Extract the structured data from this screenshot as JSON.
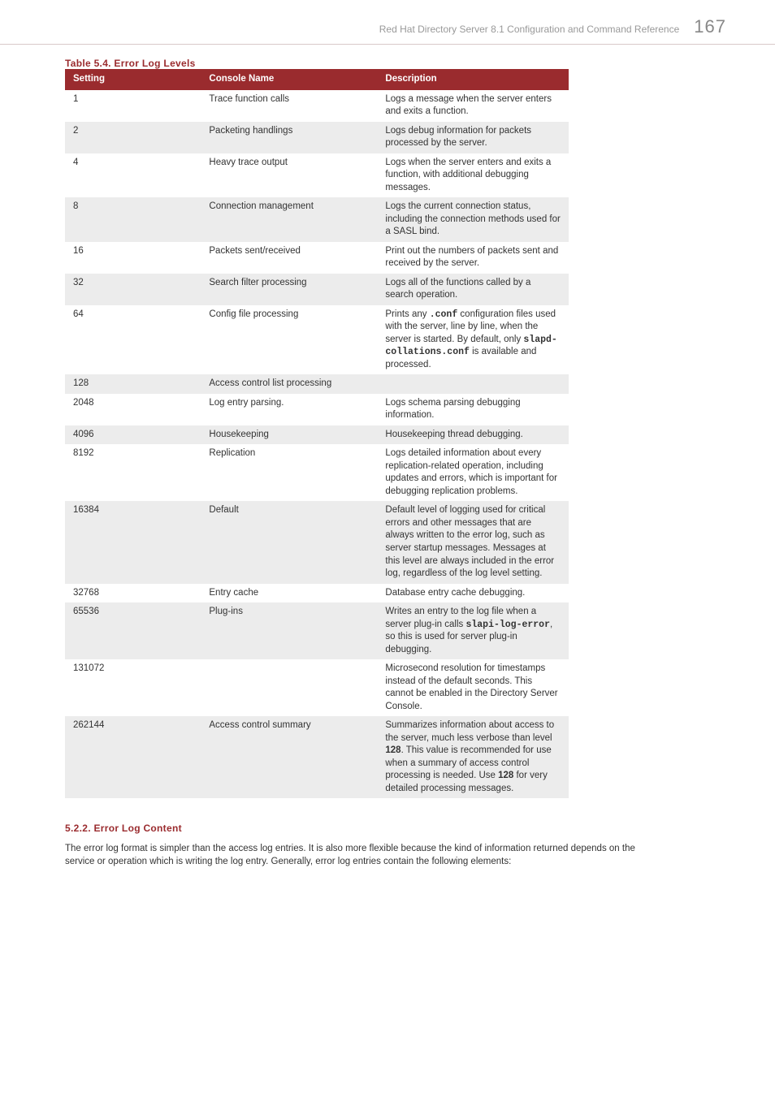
{
  "header": {
    "title": "Red Hat Directory Server 8.1 Configuration and Command Reference",
    "page_number": "167"
  },
  "table": {
    "caption": "Table 5.4. Error Log Levels",
    "headers": {
      "setting": "Setting",
      "console": "Console Name",
      "description": "Description"
    },
    "rows": [
      {
        "setting": "1",
        "console": "Trace function calls",
        "description": "Logs a message when the server enters and exits a function."
      },
      {
        "setting": "2",
        "console": "Packeting handlings",
        "description": "Logs debug information for packets processed by the server."
      },
      {
        "setting": "4",
        "console": "Heavy trace output",
        "description": "Logs when the server enters and exits a function, with additional debugging messages."
      },
      {
        "setting": "8",
        "console": "Connection management",
        "description": "Logs the current connection status, including the connection methods used for a SASL bind."
      },
      {
        "setting": "16",
        "console": "Packets sent/received",
        "description": "Print out the numbers of packets sent and received by the server."
      },
      {
        "setting": "32",
        "console": "Search filter processing",
        "description": "Logs all of the functions called by a search operation."
      },
      {
        "setting": "64",
        "console": "Config file processing",
        "description_parts": [
          {
            "t": "text",
            "v": "Prints any "
          },
          {
            "t": "code",
            "v": ".conf"
          },
          {
            "t": "text",
            "v": " configuration files used with the server, line by line, when the server is started. By default, only "
          },
          {
            "t": "code",
            "v": "slapd-collations.conf"
          },
          {
            "t": "text",
            "v": " is available and processed."
          }
        ]
      },
      {
        "setting": "128",
        "console": "Access control list processing",
        "description": ""
      },
      {
        "setting": "2048",
        "console": "Log entry parsing.",
        "description": "Logs schema parsing debugging information."
      },
      {
        "setting": "4096",
        "console": "Housekeeping",
        "description": "Housekeeping thread debugging."
      },
      {
        "setting": "8192",
        "console": "Replication",
        "description": "Logs detailed information about every replication-related operation, including updates and errors, which is important for debugging replication problems."
      },
      {
        "setting": "16384",
        "console": "Default",
        "description": "Default level of logging used for critical errors and other messages that are always written to the error log, such as server startup messages. Messages at this level are always included in the error log, regardless of the log level setting."
      },
      {
        "setting": "32768",
        "console": "Entry cache",
        "description": "Database entry cache debugging."
      },
      {
        "setting": "65536",
        "console": "Plug-ins",
        "description_parts": [
          {
            "t": "text",
            "v": "Writes an entry to the log file when a server plug-in calls "
          },
          {
            "t": "code",
            "v": "slapi-log-error"
          },
          {
            "t": "text",
            "v": ", so this is used for server plug-in debugging."
          }
        ]
      },
      {
        "setting": "131072",
        "console": "",
        "description": "Microsecond resolution for timestamps instead of the default seconds. This cannot be enabled in the Directory Server Console."
      },
      {
        "setting": "262144",
        "console": "Access control summary",
        "description_parts": [
          {
            "t": "text",
            "v": "Summarizes information about access to the server, much less verbose than level "
          },
          {
            "t": "bold",
            "v": "128"
          },
          {
            "t": "text",
            "v": ". This value is recommended for use when a summary of access control processing is needed. Use "
          },
          {
            "t": "bold",
            "v": "128"
          },
          {
            "t": "text",
            "v": " for very detailed processing messages."
          }
        ]
      }
    ]
  },
  "section": {
    "heading": "5.2.2. Error Log Content",
    "paragraph": "The error log format is simpler than the access log entries. It is also more flexible because the kind of information returned depends on the service or operation which is writing the log entry. Generally, error log entries contain the following elements:"
  }
}
